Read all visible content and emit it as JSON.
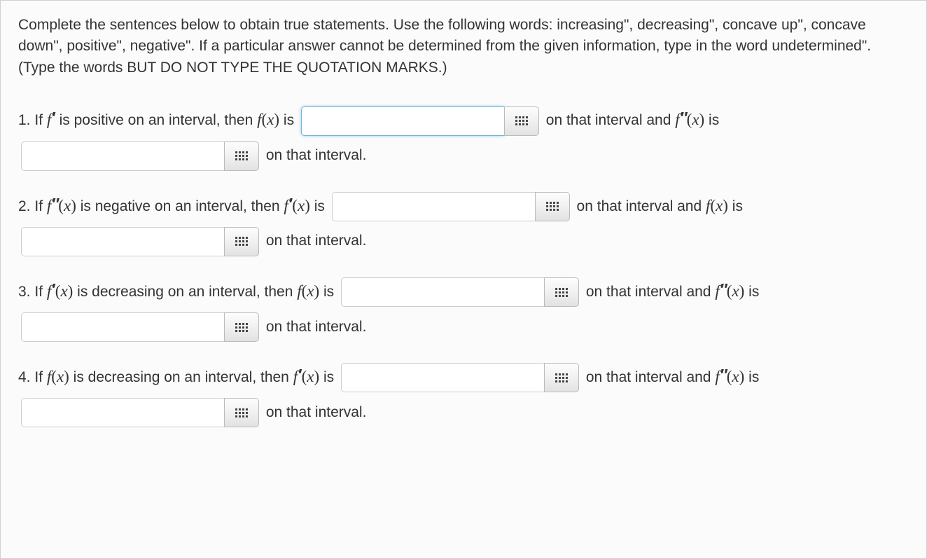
{
  "instructions": "Complete the sentences below to obtain true statements. Use the following words: increasing\", decreasing\", concave up\", concave down\", positive\", negative\". If a particular answer cannot be determined from the given information, type in the word undetermined\". (Type the words BUT DO NOT TYPE THE QUOTATION MARKS.)",
  "questions": [
    {
      "num": "1.",
      "lead_text": "If ",
      "cond_fn": "f′",
      "cond_rest": " is positive on an interval, then ",
      "target1_fn": "f(x)",
      "target1_is": " is ",
      "mid_text": " on that interval and ",
      "target2_fn": "f″(x)",
      "target2_is": " is ",
      "end_text": " on that interval.",
      "input1": "",
      "input2": ""
    },
    {
      "num": "2.",
      "lead_text": "If ",
      "cond_fn": "f″(x)",
      "cond_rest": " is negative on an interval, then ",
      "target1_fn": "f′(x)",
      "target1_is": " is ",
      "mid_text": " on that interval and ",
      "target2_fn": "f(x)",
      "target2_is": " is ",
      "end_text": " on that interval.",
      "input1": "",
      "input2": ""
    },
    {
      "num": "3.",
      "lead_text": "If ",
      "cond_fn": "f′(x)",
      "cond_rest": " is decreasing on an interval, then ",
      "target1_fn": "f(x)",
      "target1_is": " is ",
      "mid_text": " on that interval and ",
      "target2_fn": "f″(x)",
      "target2_is": " is ",
      "end_text": " on that interval.",
      "input1": "",
      "input2": ""
    },
    {
      "num": "4.",
      "lead_text": "If ",
      "cond_fn": "f(x)",
      "cond_rest": " is decreasing on an interval, then ",
      "target1_fn": "f′(x)",
      "target1_is": " is ",
      "mid_text": " on that interval and ",
      "target2_fn": "f″(x)",
      "target2_is": " is ",
      "end_text": " on that interval.",
      "input1": "",
      "input2": ""
    }
  ]
}
